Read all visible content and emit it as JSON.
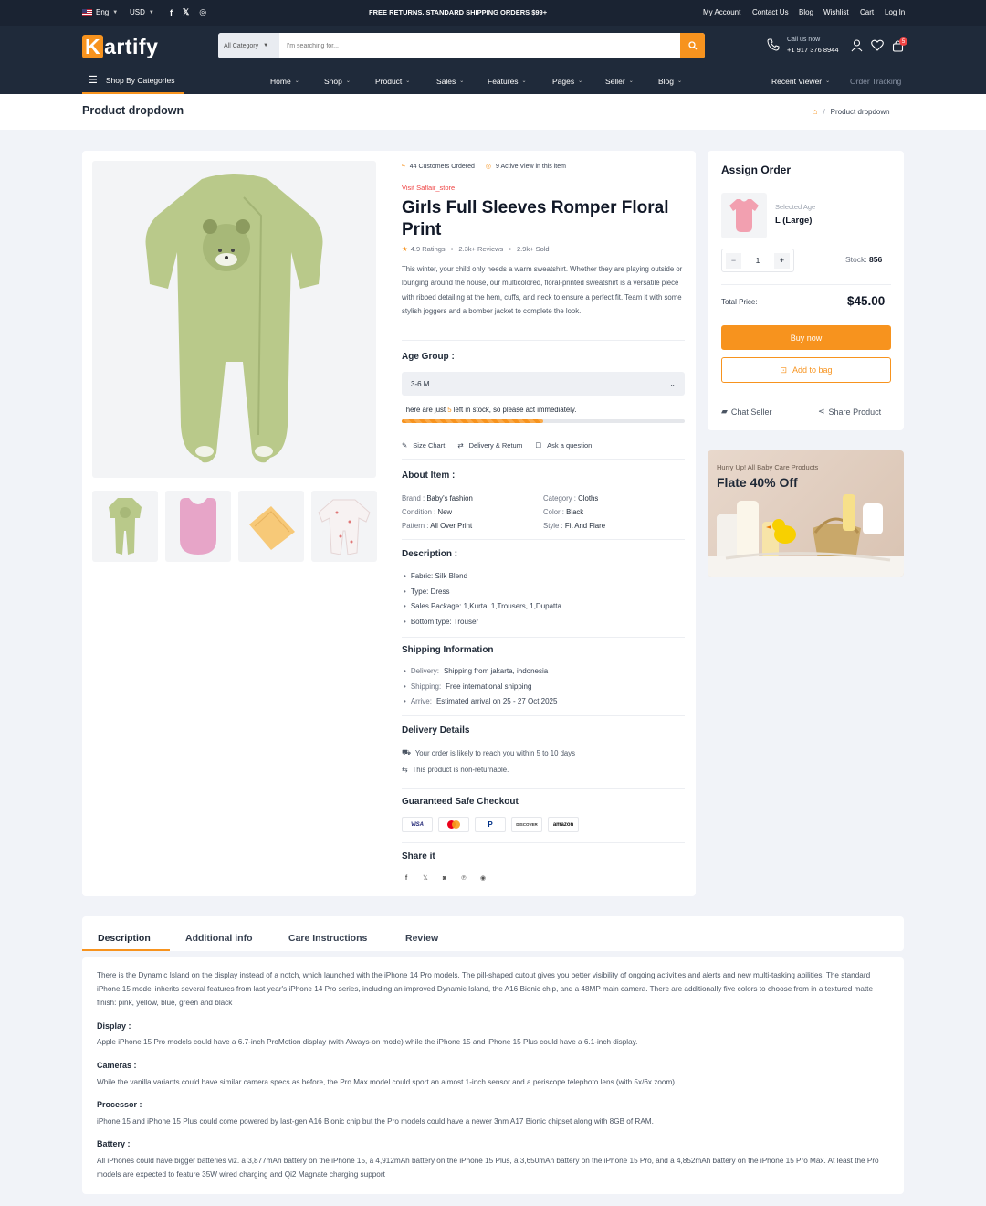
{
  "topbar": {
    "lang": "Eng",
    "currency": "USD",
    "promo": "FREE RETURNS. STANDARD SHIPPING ORDERS $99+",
    "links": [
      "My Account",
      "Contact Us",
      "Blog",
      "Wishlist",
      "Cart",
      "Log In"
    ]
  },
  "header": {
    "logo_letter": "K",
    "logo_rest": "artify",
    "category": "All Category",
    "search_placeholder": "I'm searching for...",
    "call_label": "Call us now",
    "call_number": "+1 917 376 8944",
    "cart_count": "5"
  },
  "nav": {
    "shop_by": "Shop By Categories",
    "items": [
      "Home",
      "Shop",
      "Product",
      "Sales",
      "Features",
      "Pages",
      "Seller",
      "Blog"
    ],
    "recent": "Recent Viewer",
    "tracking": "Order Tracking"
  },
  "breadcrumb": {
    "title": "Product dropdown",
    "current": "Product dropdown"
  },
  "product": {
    "customers_ordered": "44 Customers Ordered",
    "active_view": "9 Active View in this item",
    "store": "Visit Saflair_store",
    "title": "Girls Full Sleeves Romper Floral Print",
    "ratings": "4.9 Ratings",
    "reviews": "2.3k+ Reviews",
    "sold": "2.9k+ Sold",
    "description": "This winter, your child only needs a warm sweatshirt. Whether they are playing outside or lounging around the house, our multicolored, floral-printed sweatshirt is a versatile piece with ribbed detailing at the hem, cuffs, and neck to ensure a perfect fit. Team it with some stylish joggers and a bomber jacket to complete the look.",
    "age_group_label": "Age Group :",
    "age_group_value": "3-6 M",
    "stock_pre": "There are just ",
    "stock_num": "5",
    "stock_post": " left in stock, so please act immediately.",
    "stock_progress": 0.5,
    "size_chart": "Size Chart",
    "delivery_return": "Delivery & Return",
    "ask_question": "Ask a question"
  },
  "about": {
    "title": "About Item :",
    "brand_label": "Brand :",
    "brand": "Baby's fashion",
    "category_label": "Category :",
    "category": "Cloths",
    "condition_label": "Condition :",
    "condition": "New",
    "color_label": "Color :",
    "color": "Black",
    "pattern_label": "Pattern :",
    "pattern": "All Over Print",
    "style_label": "Style :",
    "style": "Fit And Flare"
  },
  "desc_list": {
    "title": "Description :",
    "items": [
      "Fabric: Silk Blend",
      "Type: Dress",
      "Sales Package: 1,Kurta, 1,Trousers, 1,Dupatta",
      "Bottom type: Trouser"
    ]
  },
  "shipping": {
    "title": "Shipping Information",
    "delivery_label": "Delivery:",
    "delivery": "Shipping from jakarta, indonesia",
    "shipping_label": "Shipping:",
    "shipping": "Free international shipping",
    "arrive_label": "Arrive:",
    "arrive": "Estimated arrival on 25 - 27 Oct 2025"
  },
  "delivery": {
    "title": "Delivery Details",
    "line1": "Your order is likely to reach you within 5 to 10 days",
    "line2": "This product is non-returnable."
  },
  "checkout": {
    "title": "Guaranteed Safe Checkout",
    "cards": [
      "VISA",
      "",
      "P",
      "DISCOVER",
      "amazon"
    ]
  },
  "share": {
    "title": "Share it"
  },
  "order": {
    "title": "Assign Order",
    "selected_label": "Selected Age",
    "selected_value": "L (Large)",
    "qty": "1",
    "stock_label": "Stock:",
    "stock_value": "856",
    "total_label": "Total Price:",
    "total_value": "$45.00",
    "buy_now": "Buy now",
    "add_to_bag": "Add to bag",
    "chat": "Chat Seller",
    "share": "Share Product"
  },
  "promo_card": {
    "small": "Hurry Up! All Baby Care Products",
    "big": "Flate 40% Off"
  },
  "tabs": [
    "Description",
    "Additional info",
    "Care Instructions",
    "Review"
  ],
  "details": {
    "intro": "There is the Dynamic Island on the display instead of a notch, which launched with the iPhone 14 Pro models. The pill-shaped cutout gives you better visibility of ongoing activities and alerts and new multi-tasking abilities. The standard iPhone 15 model inherits several features from last year's iPhone 14 Pro series, including an improved Dynamic Island, the A16 Bionic chip, and a 48MP main camera. There are additionally five colors to choose from in a textured matte finish: pink, yellow, blue, green and black",
    "display_h": "Display :",
    "display": "Apple iPhone 15 Pro models could have a 6.7-inch ProMotion display (with Always-on mode) while the iPhone 15 and iPhone 15 Plus could have a 6.1-inch display.",
    "cameras_h": "Cameras :",
    "cameras": "While the vanilla variants could have similar camera specs as before, the Pro Max model could sport an almost 1-inch sensor and a periscope telephoto lens (with 5x/6x zoom).",
    "processor_h": "Processor :",
    "processor": "iPhone 15 and iPhone 15 Plus could come powered by last-gen A16 Bionic chip but the Pro models could have a newer 3nm A17 Bionic chipset along with 8GB of RAM.",
    "battery_h": "Battery :",
    "battery": "All iPhones could have bigger batteries viz. a 3,877mAh battery on the iPhone 15, a 4,912mAh battery on the iPhone 15 Plus, a 3,650mAh battery on the iPhone 15 Pro, and a 4,852mAh battery on the iPhone 15 Pro Max. At least the Pro models are expected to feature 35W wired charging and Qi2 Magnate charging support"
  },
  "colors": {
    "accent": "#f7931e",
    "dark": "#1f2a3a",
    "alert": "#ef4444"
  }
}
